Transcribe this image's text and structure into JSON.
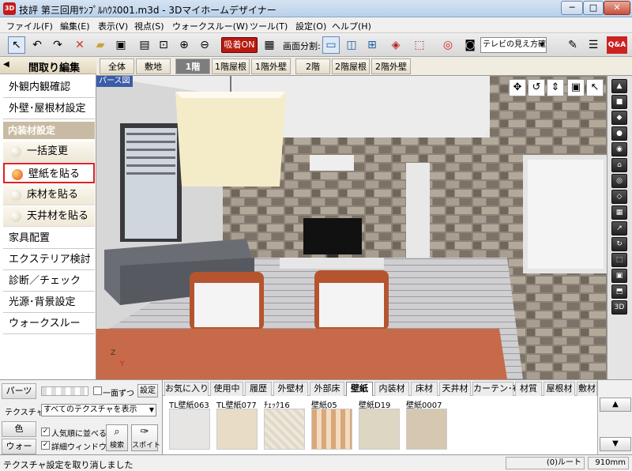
{
  "window": {
    "title": "技評 第三回用ｻﾝﾌﾟﾙﾊｳｽ001.m3d - 3Dマイホームデザイナー",
    "app_icon": "3D",
    "min": "─",
    "max": "□",
    "close": "✕"
  },
  "menu": [
    "ファイル(F)",
    "編集(E)",
    "表示(V)",
    "視点(S)",
    "ウォークスルー(W)",
    "ツール(T)",
    "設定(O)",
    "ヘルプ(H)"
  ],
  "toolbar": {
    "suction_label": "吸着ON",
    "split_label": "画面分割:",
    "view_select": "テレビの見え方確",
    "qa_label": "Q&A",
    "buttons": [
      "select-arrow-icon",
      "undo-icon",
      "redo-icon",
      "delete-icon",
      "open-folder-icon",
      "save-icon",
      "fit-view-icon",
      "zoom-in-icon",
      "zoom-out-icon"
    ]
  },
  "left_panel": {
    "header": "間取り編集",
    "collapse_arrow": "◀",
    "buttons": [
      "外観内観確認",
      "外壁･屋根材設定"
    ],
    "section": "内装材設定",
    "sub_items": [
      "一括変更",
      "壁紙を貼る",
      "床材を貼る",
      "天井材を貼る"
    ],
    "active_sub": "壁紙を貼る",
    "more_buttons": [
      "家具配置",
      "エクステリア検討",
      "診断／チェック",
      "光源･背景設定",
      "ウォークスルー"
    ]
  },
  "floor_tabs": [
    "全体",
    "敷地",
    "1階",
    "1階屋根",
    "1階外壁",
    "2階",
    "2階屋根",
    "2階外壁"
  ],
  "active_floor_tab": "1階",
  "viewport": {
    "label": "パース図",
    "axis_z": "Z",
    "axis_y": "Y",
    "nav_icons": [
      "✥",
      "↺",
      "⇕",
      "▣",
      "↖"
    ]
  },
  "right_strip_icons": [
    "▲",
    "■",
    "◆",
    "●",
    "◉",
    "⌂",
    "◎",
    "◇",
    "▦",
    "↗",
    "↻",
    "⬚",
    "▣",
    "⬒",
    "3D"
  ],
  "bottom": {
    "parts_tab": "パーツ",
    "texture_label": "テクスチャ",
    "color_tab": "色",
    "walk_tab": "ウォーク",
    "each_face_label": "一面ずつ",
    "settings_button": "設定",
    "texture_select": "すべてのテクスチャを表示",
    "popular_label": "人気順に並べる",
    "detail_label": "詳細ウィンドウ",
    "search_button": "検索",
    "spoit_button": "スポイト",
    "material_tabs": [
      "お気に入り",
      "使用中",
      "履歴",
      "外壁材",
      "外部床",
      "壁紙",
      "内装材",
      "床材",
      "天井材",
      "カーテン･布",
      "材質",
      "屋根材",
      "敷材"
    ],
    "active_material_tab": "壁紙",
    "swatches": [
      {
        "name": "TL壁紙063",
        "color": "#e7e5e3"
      },
      {
        "name": "TL壁紙077",
        "color": "#e8dcc6"
      },
      {
        "name": "ﾁｪｯｸ16",
        "color": "#ede8dc"
      },
      {
        "name": "壁紙05",
        "color": "#d9a77a"
      },
      {
        "name": "壁紙D19",
        "color": "#dcd6c2"
      },
      {
        "name": "壁紙0007",
        "color": "#d6c8b0"
      }
    ],
    "scroll_up": "▲",
    "scroll_down": "▼"
  },
  "status": {
    "message": "テクスチャ設定を取り消しました",
    "route": "(0)ルート",
    "size": "910mm"
  }
}
